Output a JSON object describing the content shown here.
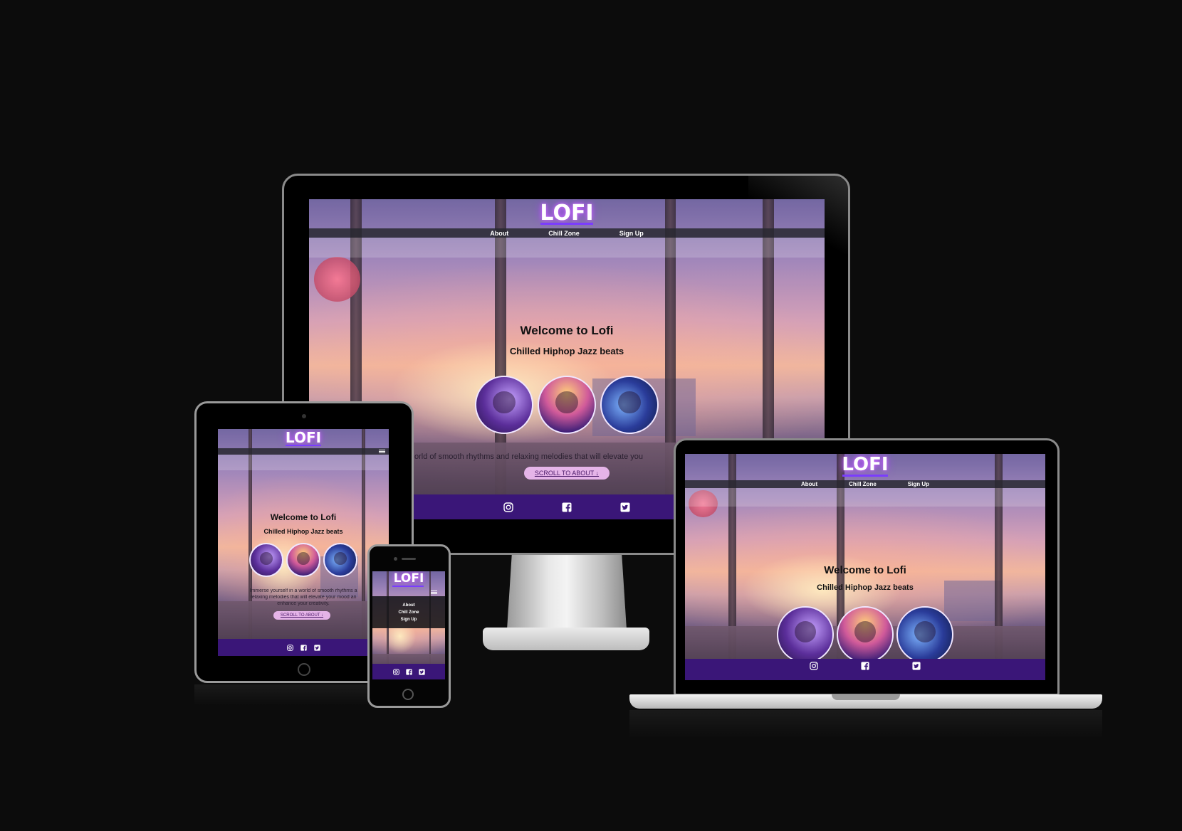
{
  "site": {
    "brand": "LOFI",
    "nav": [
      "About",
      "Chill Zone",
      "Sign Up"
    ],
    "hero_title": "Welcome to Lofi",
    "hero_subtitle": "Chilled Hiphop Jazz beats",
    "monitor_intro": "orld of smooth rhythms and relaxing melodies that will elevate you",
    "tablet_intro_line1": "Immerse yourself in a world of smooth rhythms a",
    "tablet_intro_line2": "relaxing melodies that will elevate your mood an",
    "tablet_intro_line3": "enhance your creativity.",
    "scroll_button": "SCROLL TO ABOUT ↓",
    "social_icons": [
      "instagram-icon",
      "facebook-icon",
      "twitter-icon"
    ]
  },
  "colors": {
    "background": "#0c0c0c",
    "footer": "#3a1678",
    "button": "#e5b4e8",
    "brand_glow": "#a640ff"
  }
}
